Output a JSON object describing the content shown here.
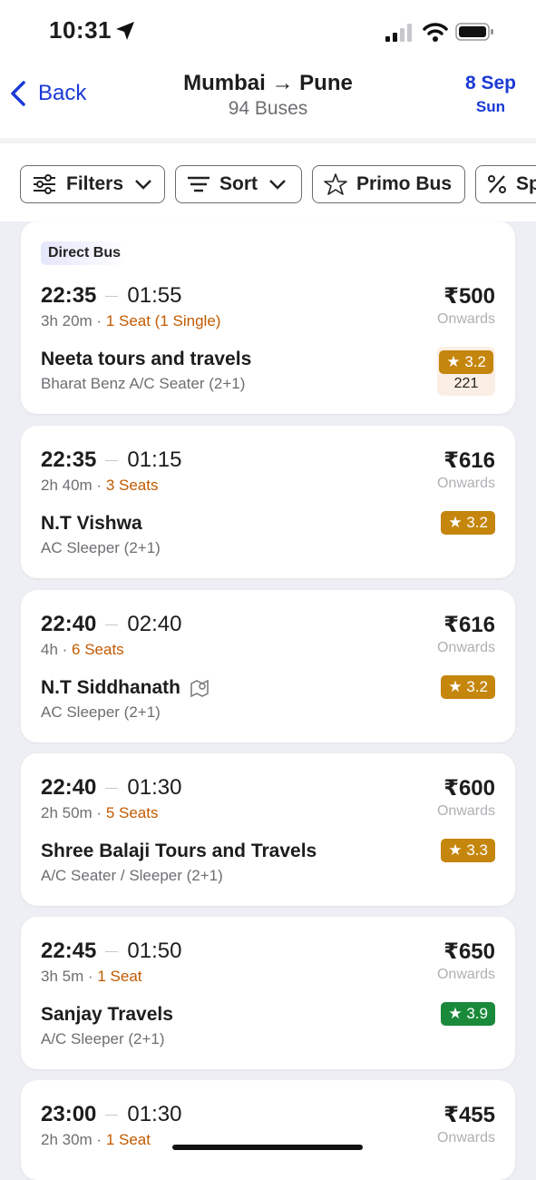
{
  "status": {
    "time": "10:31"
  },
  "header": {
    "back_label": "Back",
    "route": "Mumbai → Pune",
    "bus_count": "94 Buses",
    "date": "8 Sep",
    "day": "Sun"
  },
  "filters": [
    {
      "label": "Filters",
      "icon": "sliders-icon"
    },
    {
      "label": "Sort",
      "icon": "sort-lines-icon"
    },
    {
      "label": "Primo Bus",
      "icon": "star-icon"
    },
    {
      "label": "Sp",
      "icon": "percent-icon"
    }
  ],
  "buses": [
    {
      "badge": "Direct Bus",
      "dep": "22:35",
      "arr": "01:55",
      "duration": "3h 20m",
      "seats": "1 Seat (1 Single)",
      "operator": "Neeta tours and travels",
      "bus_type": "Bharat Benz A/C Seater (2+1)",
      "price": "₹500",
      "onwards": "Onwards",
      "rating": "★ 3.2",
      "rating_count": "221",
      "rating_color": "#c5860d"
    },
    {
      "dep": "22:35",
      "arr": "01:15",
      "duration": "2h 40m",
      "seats": "3 Seats",
      "operator": "N.T Vishwa",
      "bus_type": "AC Sleeper (2+1)",
      "price": "₹616",
      "onwards": "Onwards",
      "rating": "★ 3.2",
      "rating_color": "#c5860d"
    },
    {
      "dep": "22:40",
      "arr": "02:40",
      "duration": "4h",
      "seats": "6 Seats",
      "operator": "N.T Siddhanath",
      "operator_icon": "live-tracking-icon",
      "bus_type": "AC Sleeper (2+1)",
      "price": "₹616",
      "onwards": "Onwards",
      "rating": "★ 3.2",
      "rating_color": "#c5860d"
    },
    {
      "dep": "22:40",
      "arr": "01:30",
      "duration": "2h 50m",
      "seats": "5 Seats",
      "operator": "Shree Balaji Tours and Travels",
      "bus_type": "A/C Seater / Sleeper (2+1)",
      "price": "₹600",
      "onwards": "Onwards",
      "rating": "★ 3.3",
      "rating_color": "#c5860d"
    },
    {
      "dep": "22:45",
      "arr": "01:50",
      "duration": "3h 5m",
      "seats": "1 Seat",
      "operator": "Sanjay Travels",
      "bus_type": "A/C Sleeper (2+1)",
      "price": "₹650",
      "onwards": "Onwards",
      "rating": "★ 3.9",
      "rating_color": "#1a8a3a"
    },
    {
      "dep": "23:00",
      "arr": "01:30",
      "duration": "2h 30m",
      "seats": "1 Seat",
      "price": "₹455",
      "onwards": "Onwards"
    }
  ]
}
